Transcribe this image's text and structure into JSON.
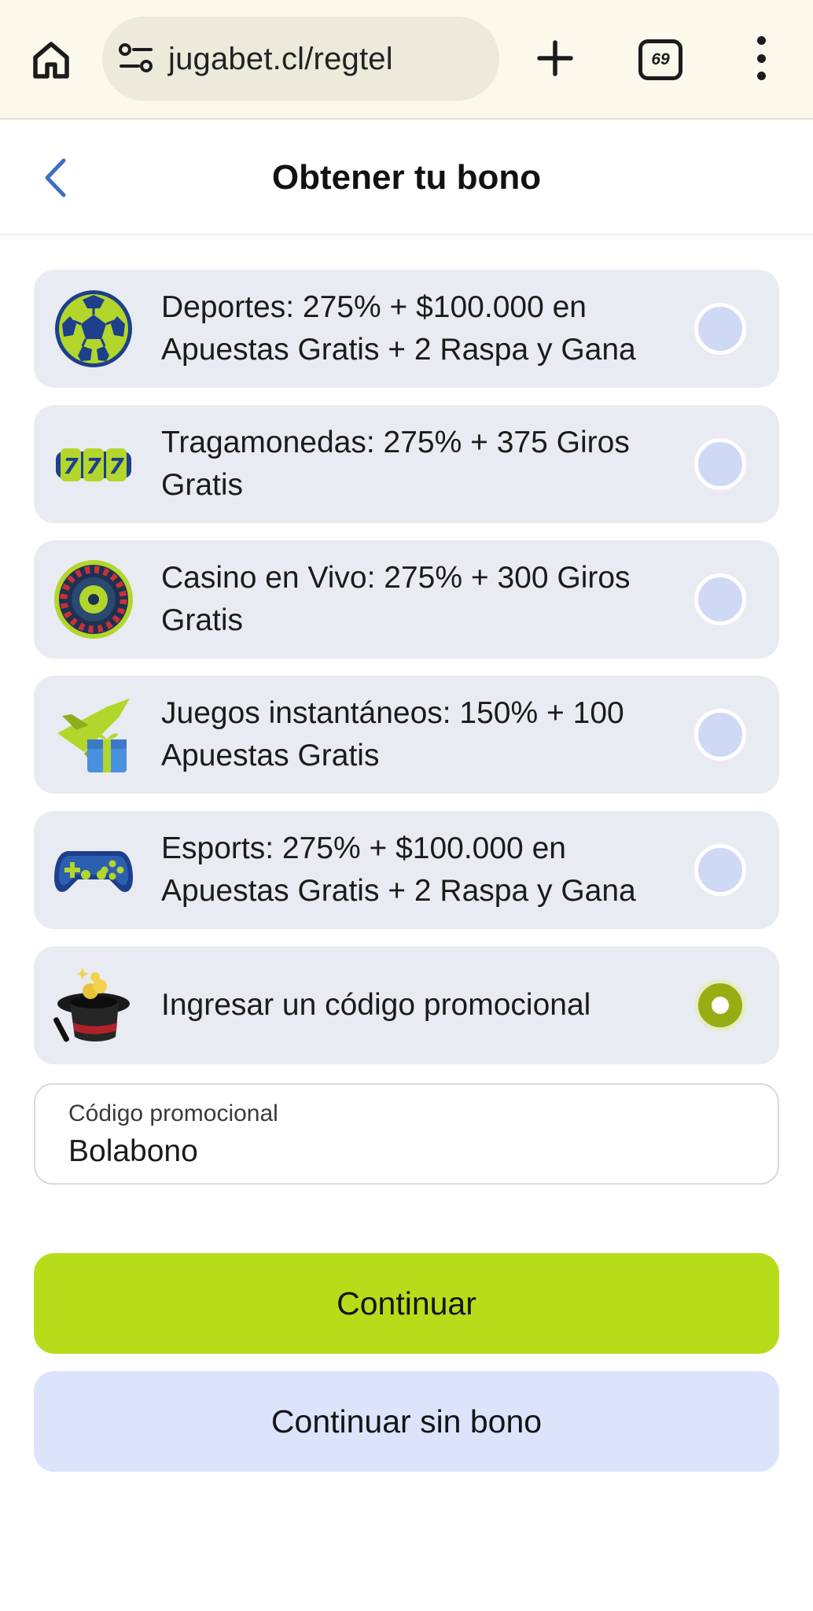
{
  "browser": {
    "url": "jugabet.cl/regtel",
    "tab_count": "69",
    "icons": [
      "home-icon",
      "site-settings-icon",
      "new-tab-icon",
      "tab-switcher-icon",
      "more-menu-icon"
    ]
  },
  "header": {
    "title": "Obtener tu bono",
    "back_icon": "chevron-left-icon"
  },
  "options": [
    {
      "label": "Deportes: 275% + $100.000 en Apuestas Gratis + 2 Raspa y Gana",
      "icon": "soccer-ball-icon",
      "selected": false
    },
    {
      "label": "Tragamonedas: 275% + 375 Giros Gratis",
      "icon": "slot-777-icon",
      "selected": false
    },
    {
      "label": "Casino en Vivo: 275% + 300 Giros Gratis",
      "icon": "roulette-wheel-icon",
      "selected": false
    },
    {
      "label": "Juegos instantáneos: 150% + 100 Apuestas Gratis",
      "icon": "plane-gift-icon",
      "selected": false
    },
    {
      "label": "Esports: 275% + $100.000 en Apuestas Gratis + 2 Raspa y Gana",
      "icon": "gamepad-icon",
      "selected": false
    },
    {
      "label": "Ingresar un código promocional",
      "icon": "magic-hat-icon",
      "selected": true
    }
  ],
  "promo": {
    "label": "Código promocional",
    "value": "Bolabono"
  },
  "buttons": {
    "continue": "Continuar",
    "continue_without": "Continuar sin bono"
  },
  "colors": {
    "accent": "#b7dd1a",
    "radio_selected": "#98ad14",
    "radio_idle": "#cfd8f4",
    "card_bg": "#e8ebf1",
    "secondary_button": "#dbe4fb",
    "back_chevron": "#3d6fc0"
  }
}
